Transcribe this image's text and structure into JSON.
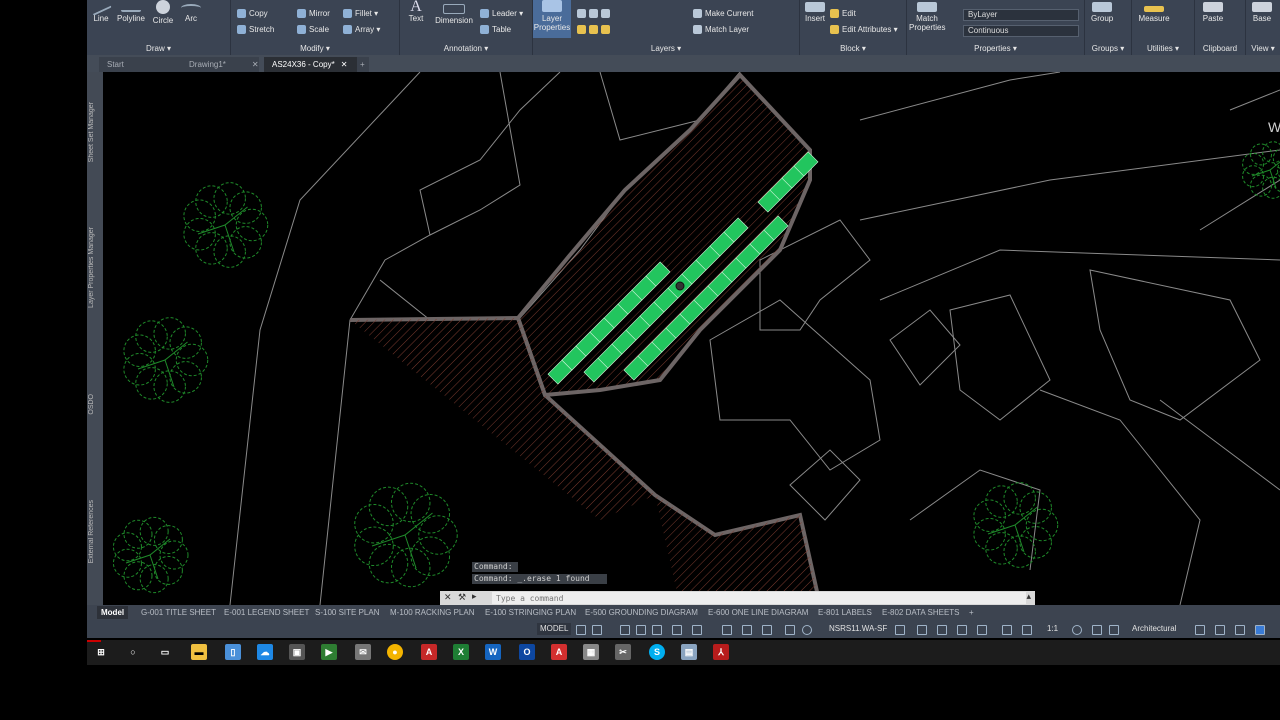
{
  "ribbon": {
    "draw": {
      "title": "Draw ▾",
      "line": "Line",
      "polyline": "Polyline",
      "circle": "Circle",
      "arc": "Arc"
    },
    "modify": {
      "title": "Modify ▾",
      "copy": "Copy",
      "mirror": "Mirror",
      "fillet": "Fillet ▾",
      "stretch": "Stretch",
      "scale": "Scale",
      "array": "Array ▾"
    },
    "annotation": {
      "title": "Annotation ▾",
      "text": "Text",
      "dimension": "Dimension",
      "leader": "Leader ▾",
      "table": "Table"
    },
    "layers": {
      "title": "Layers ▾",
      "layer_properties": "Layer Properties",
      "make_current": "Make Current",
      "match_layer": "Match Layer"
    },
    "block": {
      "title": "Block ▾",
      "insert": "Insert",
      "edit": "Edit",
      "edit_attributes": "Edit Attributes ▾"
    },
    "properties": {
      "title": "Properties ▾",
      "match_properties": "Match Properties",
      "color_value": "ByLayer",
      "linetype_value": "Continuous"
    },
    "groups": {
      "title": "Groups ▾",
      "group": "Group"
    },
    "utilities": {
      "title": "Utilities ▾",
      "measure": "Measure"
    },
    "clipboard": {
      "title": "Clipboard",
      "paste": "Paste"
    },
    "view": {
      "title": "View ▾",
      "base": "Base"
    }
  },
  "doc_tabs": [
    "Start",
    "Drawing1*",
    "AS24X36 - Copy*"
  ],
  "palettes": [
    "Sheet Set Manager",
    "Layer Properties Manager",
    "OSDO",
    "External References"
  ],
  "command": {
    "history": [
      "Command:",
      "Command: _.erase 1 found"
    ],
    "placeholder": "Type a command"
  },
  "layout_tabs": [
    "Model",
    "G-001 TITLE SHEET",
    "E-001 LEGEND SHEET",
    "S-100 SITE PLAN",
    "M-100 RACKING PLAN",
    "E-100 STRINGING PLAN",
    "E-500 GROUNDING DIAGRAM",
    "E-600 ONE LINE DIAGRAM",
    "E-801 LABELS",
    "E-802 DATA SHEETS"
  ],
  "status": {
    "model": "MODEL",
    "ucs": "NSRS11.WA-SF",
    "scale": "1:1",
    "units": "Architectural"
  },
  "canvas_edge_label": "W",
  "colors": {
    "panels": "#22c55e",
    "panel_stroke": "#c7f5d5",
    "property_line": "#8a8a8a",
    "hatch": "#7a3a2e",
    "trees": "#1f8a2a"
  }
}
